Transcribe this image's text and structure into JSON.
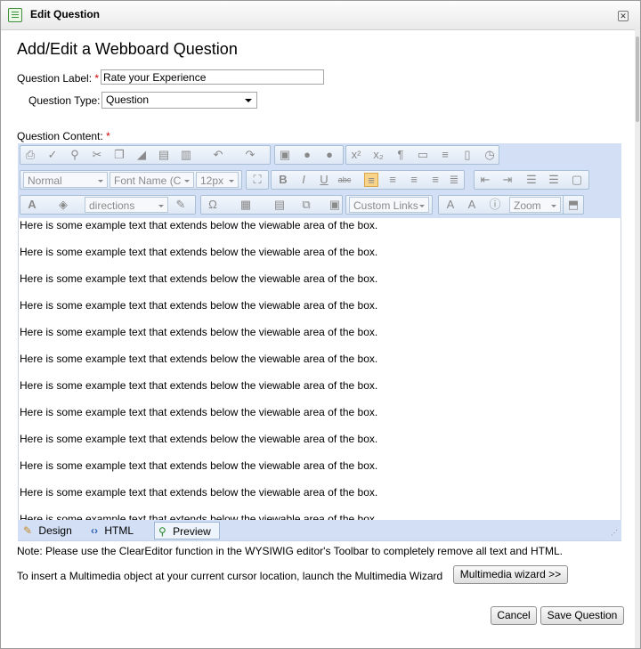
{
  "window": {
    "title": "Edit Question",
    "close_icon": "close-icon"
  },
  "heading": "Add/Edit a Webboard Question",
  "question_label": {
    "label": "Question Label:",
    "required": "*",
    "value": "Rate your Experience"
  },
  "question_type": {
    "label": "Question Type:",
    "selected": "Question"
  },
  "question_content": {
    "label": "Question Content:",
    "required": "*"
  },
  "toolbar": {
    "format_dropdown": "Normal",
    "font_name_dropdown": "Font Name (C",
    "font_size_dropdown": "12px",
    "directions_dropdown": "directions",
    "custom_links_dropdown": "Custom Links",
    "zoom_dropdown": "Zoom"
  },
  "editor": {
    "line": "Here is some example text that extends below the viewable area of the box.",
    "tabs": {
      "design": "Design",
      "html": "HTML",
      "preview": "Preview"
    }
  },
  "note": "Note: Please use the ClearEditor function in the WYSIWIG editor's Toolbar to completely remove all text and HTML.",
  "multimedia": {
    "text": "To insert a Multimedia object at your current cursor location, launch the Multimedia Wizard",
    "button": "Multimedia wizard >>"
  },
  "actions": {
    "cancel": "Cancel",
    "save": "Save Question"
  },
  "colors": {
    "toolbar_bg": "#d2dff4",
    "required": "#cc0000",
    "active_button": "#f7d48a"
  }
}
